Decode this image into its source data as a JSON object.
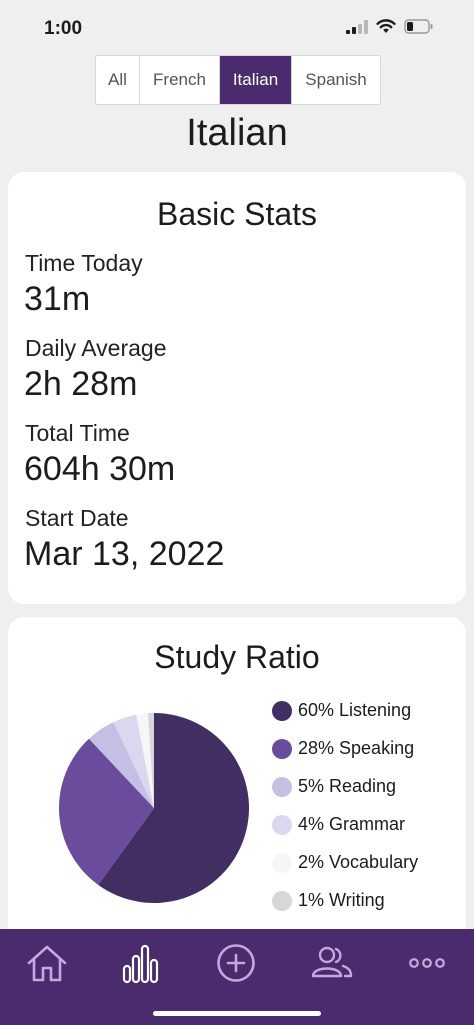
{
  "status_bar": {
    "time": "1:00"
  },
  "filter_tabs": [
    {
      "label": "All",
      "active": false
    },
    {
      "label": "French",
      "active": false
    },
    {
      "label": "Italian",
      "active": true
    },
    {
      "label": "Spanish",
      "active": false
    }
  ],
  "page_title": "Italian",
  "basic_stats": {
    "title": "Basic Stats",
    "items": [
      {
        "label": "Time Today",
        "value": "31m"
      },
      {
        "label": "Daily Average",
        "value": "2h 28m"
      },
      {
        "label": "Total Time",
        "value": "604h 30m"
      },
      {
        "label": "Start Date",
        "value": "Mar 13, 2022"
      }
    ]
  },
  "study_ratio": {
    "title": "Study Ratio",
    "legend": [
      {
        "label": "60% Listening",
        "color": "#432e64"
      },
      {
        "label": "28% Speaking",
        "color": "#6a4c9c"
      },
      {
        "label": "5% Reading",
        "color": "#c4c0e4"
      },
      {
        "label": "4% Grammar",
        "color": "#dad8ee"
      },
      {
        "label": "2% Vocabulary",
        "color": "#f6f6f8"
      },
      {
        "label": "1% Writing",
        "color": "#d7d7d7"
      }
    ]
  },
  "chart_data": {
    "type": "pie",
    "title": "Study Ratio",
    "categories": [
      "Listening",
      "Speaking",
      "Reading",
      "Grammar",
      "Vocabulary",
      "Writing"
    ],
    "values": [
      60,
      28,
      5,
      4,
      2,
      1
    ],
    "colors": [
      "#432e64",
      "#6a4c9c",
      "#c4c0e4",
      "#dad8ee",
      "#f6f6f8",
      "#d7d7d7"
    ]
  },
  "tab_bar": {
    "background": "#4a2c6e",
    "active_tab": "stats",
    "icons": [
      "home-icon",
      "stats-icon",
      "add-icon",
      "people-icon",
      "more-icon"
    ]
  }
}
